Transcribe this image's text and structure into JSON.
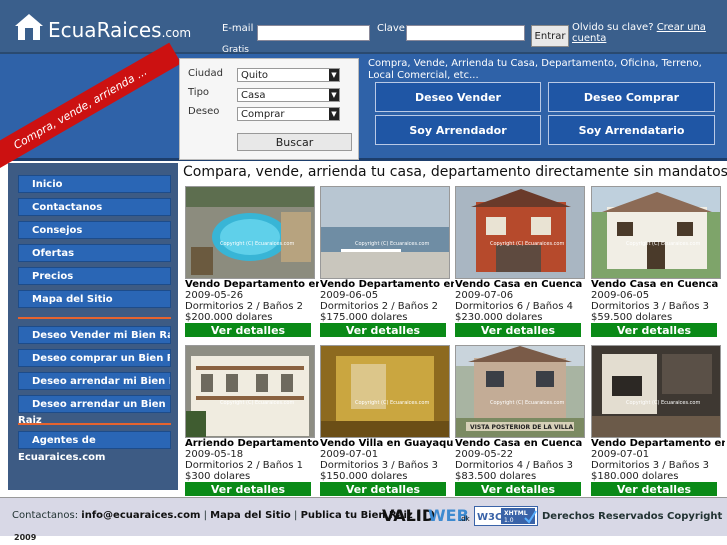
{
  "header": {
    "logo_main": "EcuaRaices",
    "logo_domain": ".com",
    "email_label": "E-mail",
    "gratis_label": "Gratis",
    "password_label": "Clave",
    "enter_label": "Entrar",
    "forgot_text": "Olvido su clave?",
    "create_account": "Crear una cuenta"
  },
  "search": {
    "ribbon": "Compra, vende, arrienda ...",
    "city_label": "Ciudad",
    "city_value": "Quito",
    "type_label": "Tipo",
    "type_value": "Casa",
    "wish_label": "Deseo",
    "wish_value": "Comprar",
    "button": "Buscar"
  },
  "tagline": "Compra, Vende, Arrienda tu Casa, Departamento, Oficina, Terreno, Local Comercial, etc...",
  "actions": [
    "Deseo Vender",
    "Deseo Comprar",
    "Soy Arrendador",
    "Soy Arrendatario"
  ],
  "sidebar": {
    "items": [
      "Inicio",
      "Contactanos",
      "Consejos",
      "Ofertas",
      "Precios",
      "Mapa del Sitio"
    ],
    "items2": [
      "Deseo Vender mi Bien Raiz",
      "Deseo comprar un Bien Raiz",
      "Deseo arrendar mi Bien Rai",
      "Deseo arrendar un Bien"
    ],
    "z_char": "z",
    "raiz_text": "Raiz",
    "agents": "Agentes de",
    "agents_site": "Ecuaraices.com"
  },
  "main": {
    "title": "Compara, vende, arrienda tu casa, departamento directamente sin mandatos",
    "details_label": "Ver detalles",
    "watermark": "Copyright (C) Ecuaraices.com",
    "listings": [
      {
        "title": "Vendo Departamento en",
        "date": "2009-05-26",
        "rooms": "Dormitorios 2 / Baños 2",
        "price": "$200.000 dolares",
        "img": "pool"
      },
      {
        "title": "Vendo Departamento en",
        "date": "2009-06-05",
        "rooms": "Dormitorios 2 / Baños 2",
        "price": "$175.000 dolares",
        "img": "sea"
      },
      {
        "title": "Vendo Casa en Cuenca",
        "date": "2009-07-06",
        "rooms": "Dormitorios 6 / Baños 4",
        "price": "$230.000 dolares",
        "img": "house-brick"
      },
      {
        "title": "Vendo Casa en Cuenca",
        "date": "2009-06-05",
        "rooms": "Dormitorios 3 / Baños 3",
        "price": "$59.500 dolares",
        "img": "house-white"
      },
      {
        "title": "Arriendo Departamento",
        "date": "2009-05-18",
        "rooms": "Dormitorios 2 / Baños 1",
        "price": "$300 dolares",
        "img": "building"
      },
      {
        "title": "Vendo Villa en Guayaquil",
        "date": "2009-07-01",
        "rooms": "Dormitorios 3 / Baños 3",
        "price": "$150.000 dolares",
        "img": "interior-yellow"
      },
      {
        "title": "Vendo Casa en Cuenca",
        "date": "2009-05-22",
        "rooms": "Dormitorios 4 / Baños 3",
        "price": "$83.500 dolares",
        "img": "house-back",
        "caption": "VISTA POSTERIOR DE LA VILLA"
      },
      {
        "title": "Vendo Departamento en",
        "date": "2009-07-01",
        "rooms": "Dormitorios 3 / Baños 3",
        "price": "$180.000 dolares",
        "img": "interior-dark"
      }
    ]
  },
  "footer": {
    "contact_label": "Contactanos:",
    "email": "info@ecuaraices.com",
    "sep": "|",
    "sitemap": "Mapa del Sitio",
    "publish": "Publica tu Bien Raiz",
    "valid_badge_main": "VALID",
    "valid_badge_web": "WEB",
    "valid_badge_dk": ".dk",
    "w3c_badge": "W3C",
    "w3c_xhtml": "XHTML",
    "w3c_version": "1.0",
    "copyright": "Derechos Reservados Copyright ©",
    "year": "2009"
  },
  "colors": {
    "header_bg": "#3a5f8c",
    "search_band": "#2f62a8",
    "ribbon": "#cc1111",
    "sidebar_bg": "#3d5b84",
    "nav_button": "#2a66b5",
    "details_button": "#0a8a17",
    "divider": "#e5632e"
  }
}
